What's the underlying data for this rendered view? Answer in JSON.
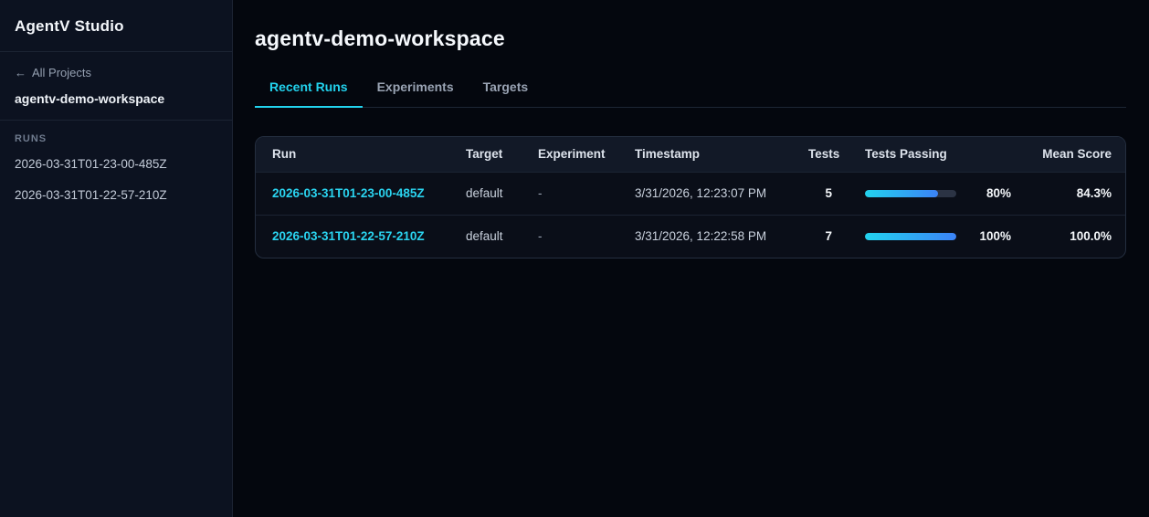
{
  "app": {
    "title": "AgentV Studio"
  },
  "sidebar": {
    "back_arrow": "←",
    "back_label": "All Projects",
    "workspace_name": "agentv-demo-workspace",
    "runs_heading": "RUNS",
    "runs": [
      "2026-03-31T01-23-00-485Z",
      "2026-03-31T01-22-57-210Z"
    ]
  },
  "main": {
    "title": "agentv-demo-workspace",
    "tabs": {
      "recent_runs": "Recent Runs",
      "experiments": "Experiments",
      "targets": "Targets"
    },
    "active_tab": "Recent Runs",
    "runs_table": {
      "columns": {
        "run": "Run",
        "target": "Target",
        "experiment": "Experiment",
        "timestamp": "Timestamp",
        "tests": "Tests",
        "tests_passing": "Tests Passing",
        "mean_score": "Mean Score"
      },
      "rows": [
        {
          "run": "2026-03-31T01-23-00-485Z",
          "target": "default",
          "experiment": "-",
          "timestamp": "3/31/2026, 12:23:07 PM",
          "tests": "5",
          "passing_pct": 80,
          "passing_label": "80%",
          "mean_score": "84.3%"
        },
        {
          "run": "2026-03-31T01-22-57-210Z",
          "target": "default",
          "experiment": "-",
          "timestamp": "3/31/2026, 12:22:58 PM",
          "tests": "7",
          "passing_pct": 100,
          "passing_label": "100%",
          "mean_score": "100.0%"
        }
      ]
    }
  },
  "colors": {
    "accent_cyan": "#22d3ee",
    "progress_gradient_start": "#22d3ee",
    "progress_gradient_end": "#3b82f6",
    "progress_track": "#2b3344"
  }
}
